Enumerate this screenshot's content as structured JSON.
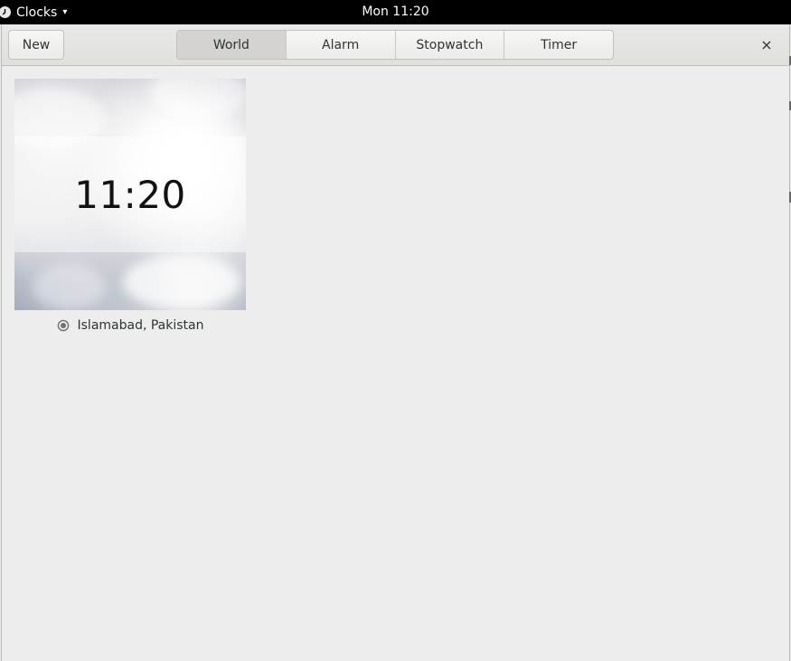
{
  "topbar": {
    "app_name": "Clocks",
    "app_menu_arrow": "▾",
    "datetime": "Mon 11:20"
  },
  "headerbar": {
    "new_label": "New",
    "tabs": [
      {
        "label": "World",
        "active": true
      },
      {
        "label": "Alarm",
        "active": false
      },
      {
        "label": "Stopwatch",
        "active": false
      },
      {
        "label": "Timer",
        "active": false
      }
    ],
    "close_glyph": "×"
  },
  "world_clocks": [
    {
      "time": "11:20",
      "location": "Islamabad, Pakistan",
      "is_current_location": true
    }
  ],
  "icons": {
    "app": "clock-icon",
    "location": "location-icon",
    "close": "close-icon"
  },
  "colors": {
    "topbar_bg": "#000000",
    "window_bg": "#ededed",
    "active_tab_bg": "#d4d3cf",
    "text": "#2e3436"
  }
}
